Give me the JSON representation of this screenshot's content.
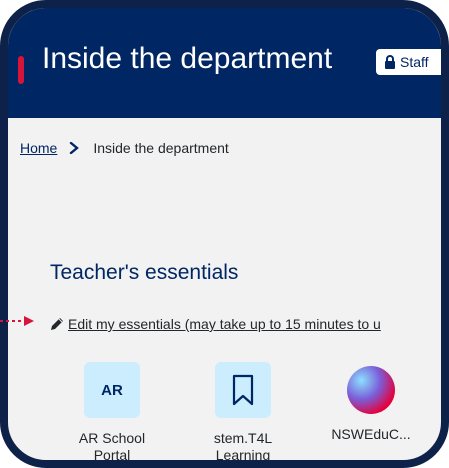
{
  "header": {
    "title": "Inside the department",
    "staff_button_label": "Staff"
  },
  "breadcrumb": {
    "home": "Home",
    "current": "Inside the department"
  },
  "essentials": {
    "heading": "Teacher's essentials",
    "edit_link": "Edit my essentials (may take up to 15 minutes to u",
    "tiles": [
      {
        "badge": "AR",
        "label_line1": "AR School",
        "label_line2": "Portal"
      },
      {
        "icon": "bookmark-icon",
        "label_line1": "stem.T4L",
        "label_line2": "Learning"
      },
      {
        "icon": "nsw-edu-logo",
        "label_line1": "NSWEduC...",
        "label_line2": ""
      }
    ]
  },
  "colors": {
    "header_bg": "#002664",
    "frame": "#0e2148",
    "tile_bg": "#cbedfd",
    "accent_red": "#d7153a"
  }
}
